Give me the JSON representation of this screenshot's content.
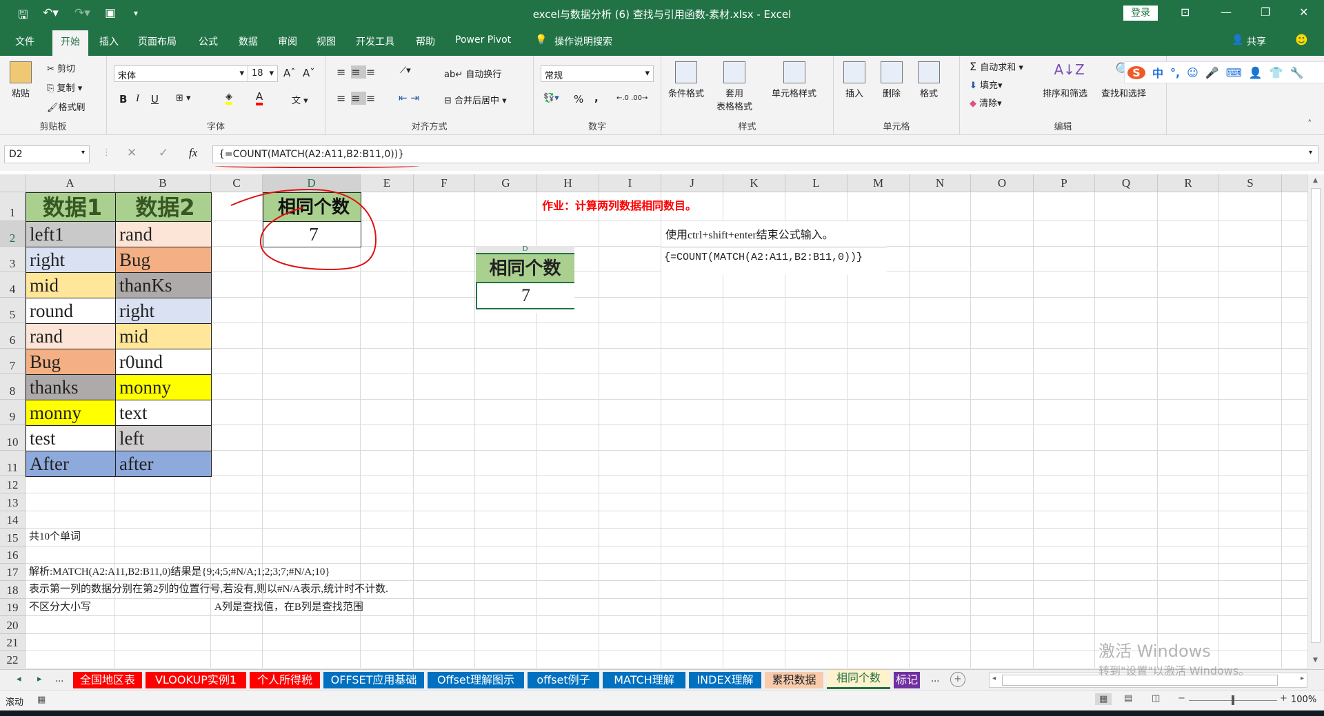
{
  "titlebar": {
    "title": "excel与数据分析 (6) 查找与引用函数-素材.xlsx - Excel",
    "login": "登录",
    "qat": [
      "save-icon",
      "undo-icon",
      "redo-icon",
      "form-icon",
      "customize-icon"
    ]
  },
  "menu": {
    "tabs": [
      "文件",
      "开始",
      "插入",
      "页面布局",
      "公式",
      "数据",
      "审阅",
      "视图",
      "开发工具",
      "帮助",
      "Power Pivot"
    ],
    "active": "开始",
    "tell_me": "操作说明搜索",
    "share": "共享"
  },
  "ribbon": {
    "clipboard": {
      "label": "剪贴板",
      "paste": "粘贴",
      "cut": "剪切",
      "copy": "复制",
      "format_painter": "格式刷"
    },
    "font": {
      "label": "字体",
      "font_name": "宋体",
      "font_size": "18",
      "bold": "B",
      "italic": "I",
      "underline": "U",
      "grow": "Aˆ",
      "shrink": "Aˇ",
      "wen": "文"
    },
    "alignment": {
      "label": "对齐方式",
      "wrap": "自动换行",
      "merge": "合并后居中"
    },
    "number": {
      "label": "数字",
      "format": "常规",
      "percent": "%",
      "comma": ","
    },
    "styles": {
      "label": "样式",
      "conditional": "条件格式",
      "table_1": "套用",
      "table_2": "表格格式",
      "cell_styles": "单元格样式"
    },
    "cells": {
      "label": "单元格",
      "insert": "插入",
      "delete": "删除",
      "format": "格式"
    },
    "editing": {
      "label": "编辑",
      "autosum": "自动求和",
      "fill": "填充",
      "clear": "清除",
      "sort": "排序和筛选",
      "find": "查找和选择"
    },
    "ime": [
      "S",
      "中",
      "°,",
      "☺",
      "🎤",
      "⌨",
      "👤",
      "👕",
      "🔧"
    ]
  },
  "formula_bar": {
    "name_box": "D2",
    "formula": "{=COUNT(MATCH(A2:A11,B2:B11,0))}",
    "fx": "fx"
  },
  "columns": [
    "A",
    "B",
    "C",
    "D",
    "E",
    "F",
    "G",
    "H",
    "I",
    "J",
    "K",
    "L",
    "M",
    "N",
    "O",
    "P",
    "Q",
    "R",
    "S"
  ],
  "selected_cell": "D2",
  "cells": {
    "A1": {
      "v": "数据1",
      "bg": "#a9d08e",
      "color": "#375623"
    },
    "B1": {
      "v": "数据2",
      "bg": "#a9d08e",
      "color": "#375623"
    },
    "D1": {
      "v": "相同个数",
      "bg": "#a9d08e",
      "color": "#111111"
    },
    "D2": {
      "v": "7",
      "bg": "#ffffff"
    },
    "A2": {
      "v": "left1",
      "bg": "#c9c9c9"
    },
    "B2": {
      "v": "rand",
      "bg": "#fce4d6"
    },
    "A3": {
      "v": "right",
      "bg": "#d9e1f2"
    },
    "B3": {
      "v": "Bug",
      "bg": "#f4b084"
    },
    "A4": {
      "v": "mid",
      "bg": "#ffe699"
    },
    "B4": {
      "v": "thanKs",
      "bg": "#aeaaaa"
    },
    "A5": {
      "v": "round",
      "bg": "#ffffff"
    },
    "B5": {
      "v": "right",
      "bg": "#d9e1f2"
    },
    "A6": {
      "v": "rand",
      "bg": "#fce4d6"
    },
    "B6": {
      "v": "mid",
      "bg": "#ffe699"
    },
    "A7": {
      "v": "Bug",
      "bg": "#f4b084"
    },
    "B7": {
      "v": "r0und",
      "bg": "#ffffff"
    },
    "A8": {
      "v": "thanks",
      "bg": "#aeaaaa"
    },
    "B8": {
      "v": "monny",
      "bg": "#ffff00"
    },
    "A9": {
      "v": "monny",
      "bg": "#ffff00"
    },
    "B9": {
      "v": "text",
      "bg": "#ffffff"
    },
    "A10": {
      "v": "test",
      "bg": "#ffffff"
    },
    "B10": {
      "v": "left",
      "bg": "#d0cece"
    },
    "A11": {
      "v": "After",
      "bg": "#8ea9db"
    },
    "B11": {
      "v": "after",
      "bg": "#8ea9db"
    }
  },
  "homework": {
    "text": "作业：计算两列数据相同数目。",
    "color": "#ff0000"
  },
  "notes": {
    "A15": "共10个单词",
    "A17": "解析:MATCH(A2:A11,B2:B11,0)结果是{9;4;5;#N/A;1;2;3;7;#N/A;10}",
    "A18": "表示第一列的数据分别在第2列的位置行号,若没有,则以#N/A表示,统计时不计数.",
    "A19": "不区分大小写",
    "C19": "A列是查找值，在B列是查找范围"
  },
  "textbox": {
    "line1": "使用ctrl+shift+enter结束公式输入。",
    "line2": "{=COUNT(MATCH(A2:A11,B2:B11,0))}"
  },
  "picture": {
    "col": "D",
    "header": "相同个数",
    "value": "7"
  },
  "sheet_tabs": [
    {
      "label": "全国地区表",
      "bg": "#ff0000",
      "color": "#ffffff"
    },
    {
      "label": "VLOOKUP实例1",
      "bg": "#ff0000",
      "color": "#ffffff"
    },
    {
      "label": "个人所得税",
      "bg": "#ff0000",
      "color": "#ffffff"
    },
    {
      "label": "OFFSET应用基础",
      "bg": "#0070c0",
      "color": "#ffffff"
    },
    {
      "label": "Offset理解图示",
      "bg": "#0070c0",
      "color": "#ffffff"
    },
    {
      "label": "offset例子",
      "bg": "#0070c0",
      "color": "#ffffff"
    },
    {
      "label": "MATCH理解",
      "bg": "#0070c0",
      "color": "#ffffff"
    },
    {
      "label": "INDEX理解",
      "bg": "#0070c0",
      "color": "#ffffff"
    },
    {
      "label": "累积数据",
      "bg": "#f8cbad",
      "color": "#222222"
    },
    {
      "label": "相同个数",
      "bg": "#fff2cc",
      "color": "#217346",
      "active": true
    },
    {
      "label": "标记",
      "bg": "#7030a0",
      "color": "#ffffff"
    }
  ],
  "tabs_more": "...",
  "status": {
    "mode": "滚动",
    "zoom": "100%",
    "zoom_value": 100
  },
  "watermark": {
    "line1": "激活 Windows",
    "line2": "转到\"设置\"以激活 Windows。"
  },
  "accent": "#217346"
}
